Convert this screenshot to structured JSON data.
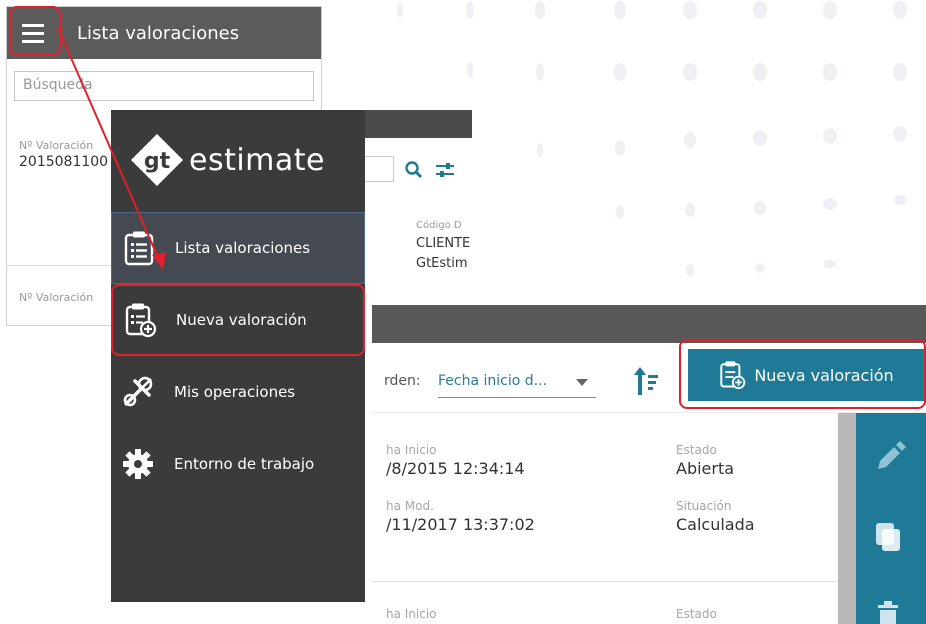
{
  "list_panel": {
    "title": "Lista valoraciones",
    "search_placeholder": "Búsqueda",
    "rows": [
      {
        "label": "Nº Valoración",
        "value": "2015081100"
      },
      {
        "label": "Nº Valoración",
        "value": ""
      }
    ]
  },
  "middle_panel": {
    "field_label": "Código D",
    "field_value_1": "CLIENTE",
    "field_value_2": "GtEstim"
  },
  "menu": {
    "logo_mark": "gt",
    "logo_text": "estimate",
    "items": [
      {
        "label": "Lista valoraciones",
        "icon": "clipboard-list-icon",
        "active": true
      },
      {
        "label": "Nueva valoración",
        "icon": "clipboard-add-icon",
        "active": false,
        "highlighted": true
      },
      {
        "label": "Mis operaciones",
        "icon": "tools-icon",
        "active": false
      },
      {
        "label": "Entorno de trabajo",
        "icon": "gear-icon",
        "active": false
      }
    ]
  },
  "detail_panel": {
    "orden_label": "rden:",
    "orden_value": "Fecha inicio d...",
    "new_button_label": "Nueva valoración",
    "record": {
      "fecha_inicio_label": "ha Inicio",
      "fecha_inicio_value": "/8/2015 12:34:14",
      "estado_label": "Estado",
      "estado_value": "Abierta",
      "fecha_mod_label": "ha Mod.",
      "fecha_mod_value": "/11/2017 13:37:02",
      "situacion_label": "Situación",
      "situacion_value": "Calculada"
    },
    "record2": {
      "fecha_inicio_label": "ha Inicio",
      "estado_label": "Estado"
    }
  },
  "colors": {
    "accent": "#1f7a97",
    "highlight": "#e0202a",
    "menu_bg": "#3b3b3b",
    "header_bg": "#5b5b5b"
  }
}
